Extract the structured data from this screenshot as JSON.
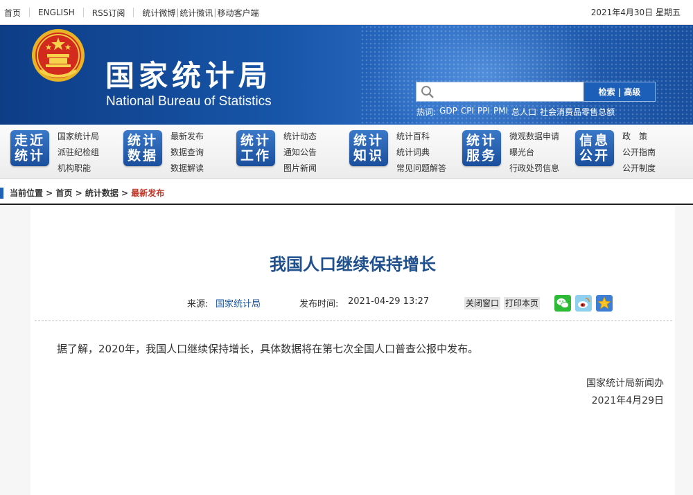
{
  "topbar": {
    "links": [
      "首页",
      "ENGLISH",
      "RSS订阅",
      "统计微博",
      "统计微讯",
      "移动客户端"
    ],
    "date": "2021年4月30日 星期五"
  },
  "header": {
    "title_cn": "国家统计局",
    "title_en": "National Bureau of Statistics",
    "search": {
      "placeholder": "",
      "button_label": "检索 | 高级"
    },
    "hot_label": "热词:",
    "hot_words": [
      "GDP",
      "CPI",
      "PPI",
      "PMI",
      "总人口",
      "社会消费品零售总额"
    ]
  },
  "nav": {
    "groups": [
      {
        "badge": [
          "走近",
          "统计"
        ],
        "links": [
          "国家统计局",
          "派驻纪检组",
          "机构职能"
        ]
      },
      {
        "badge": [
          "统计",
          "数据"
        ],
        "links": [
          "最新发布",
          "数据查询",
          "数据解读"
        ]
      },
      {
        "badge": [
          "统计",
          "工作"
        ],
        "links": [
          "统计动态",
          "通知公告",
          "图片新闻"
        ]
      },
      {
        "badge": [
          "统计",
          "知识"
        ],
        "links": [
          "统计百科",
          "统计词典",
          "常见问题解答"
        ]
      },
      {
        "badge": [
          "统计",
          "服务"
        ],
        "links": [
          "微观数据申请",
          "曝光台",
          "行政处罚信息"
        ]
      },
      {
        "badge": [
          "信息",
          "公开"
        ],
        "links": [
          "政　策",
          "公开指南",
          "公开制度"
        ]
      }
    ]
  },
  "breadcrumb": {
    "label": "当前位置 > ",
    "items": [
      "首页",
      "统计数据"
    ],
    "separator": " > ",
    "current": "最新发布"
  },
  "article": {
    "title": "我国人口继续保持增长",
    "source_label": "来源:",
    "source": "国家统计局",
    "time_label": "发布时间:",
    "time": "2021-04-29 13:27",
    "close_label": "关闭窗口",
    "print_label": "打印本页",
    "share_icons": [
      "wechat-icon",
      "weibo-icon",
      "qzone-star-icon"
    ],
    "body": "据了解，2020年，我国人口继续保持增长，具体数据将在第七次全国人口普查公报中发布。",
    "signature": "国家统计局新闻办",
    "sign_date": "2021年4月29日"
  },
  "colors": {
    "brand_blue": "#1755a8",
    "title_blue": "#1f4f8c",
    "current_red": "#c0392b"
  }
}
